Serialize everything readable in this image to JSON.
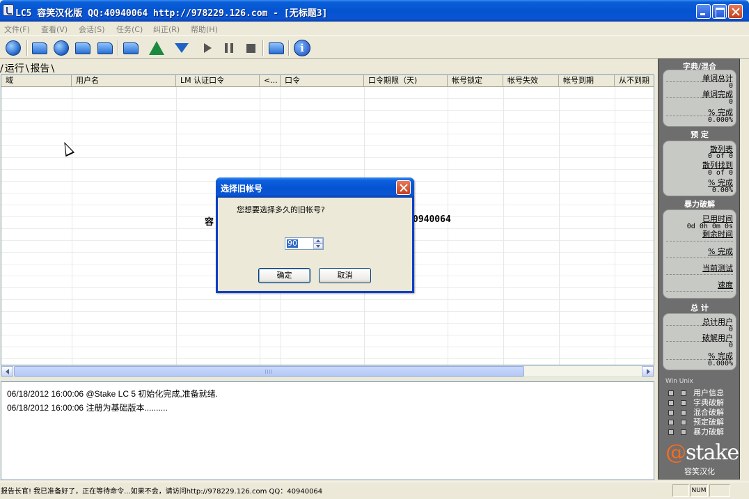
{
  "window": {
    "title": "LC5 容笑汉化版 QQ:40940064 http://978229.126.com - [无标题3]"
  },
  "menu": [
    {
      "label": "文件(F)",
      "key": "file"
    },
    {
      "label": "查看(V)",
      "key": "view"
    },
    {
      "label": "会话(S)",
      "key": "session"
    },
    {
      "label": "任务(C)",
      "key": "task"
    },
    {
      "label": "纠正(R)",
      "key": "remediate"
    },
    {
      "label": "帮助(H)",
      "key": "help"
    }
  ],
  "tabs": [
    "运行",
    "报告"
  ],
  "grid": {
    "columns": [
      "域",
      "用户名",
      "LM 认证口令",
      "<...",
      "口令",
      "口令期限（天)",
      "帐号锁定",
      "帐号失效",
      "帐号到期",
      "从不到期"
    ],
    "background_left": "容",
    "background_right": "0940064"
  },
  "log": [
    "06/18/2012 16:00:06 @Stake LC 5 初始化完成,准备就绪.",
    "06/18/2012 16:00:06 注册为基础版本.........."
  ],
  "status": {
    "text": "报告长官! 我已准备好了，正在等待命令...如果不会，请访问http://978229.126.com QQ：40940064",
    "num": "NUM"
  },
  "panel": {
    "dict_title": "字典/混合",
    "dict_words_total_label": "单词总计",
    "dict_words_total_value": "0",
    "dict_words_done_label": "单词完成",
    "dict_words_done_value": "0",
    "dict_pct_label": "% 完成",
    "dict_pct_value": "0.000%",
    "pre_title": "预 定",
    "pre_hash_label": "散列表",
    "pre_hash_value": "0 of 0",
    "pre_found_label": "散列找到",
    "pre_found_value": "0 of 0",
    "pre_pct_label": "% 完成",
    "pre_pct_value": "0.00%",
    "brute_title": "暴力破解",
    "brute_time_label": "已用时间",
    "brute_time_value": "0d 0h 0m 0s",
    "brute_remain_label": "剩余时间",
    "brute_pct_label": "% 完成",
    "brute_current_label": "当前测试",
    "brute_speed_label": "速度",
    "total_title": "总 计",
    "total_users_label": "总计用户",
    "total_users_value": "0",
    "total_cracked_label": "破解用户",
    "total_cracked_value": "0",
    "total_pct_label": "% 完成",
    "total_pct_value": "0.000%",
    "os_header": "Win Unix",
    "checks": [
      "用户信息",
      "字典破解",
      "混合破解",
      "预定破解",
      "暴力破解"
    ],
    "logo_at": "@",
    "logo_text": "stake",
    "logo_sub": "容笑汉化"
  },
  "dialog": {
    "title": "选择旧帐号",
    "prompt": "您想要选择多久的旧帐号?",
    "value": "90",
    "ok": "确定",
    "cancel": "取消"
  },
  "colors": {
    "titlebar": "#0553d0",
    "panel_bg": "#6e6e6e",
    "logo_accent": "#ff6a1a"
  }
}
